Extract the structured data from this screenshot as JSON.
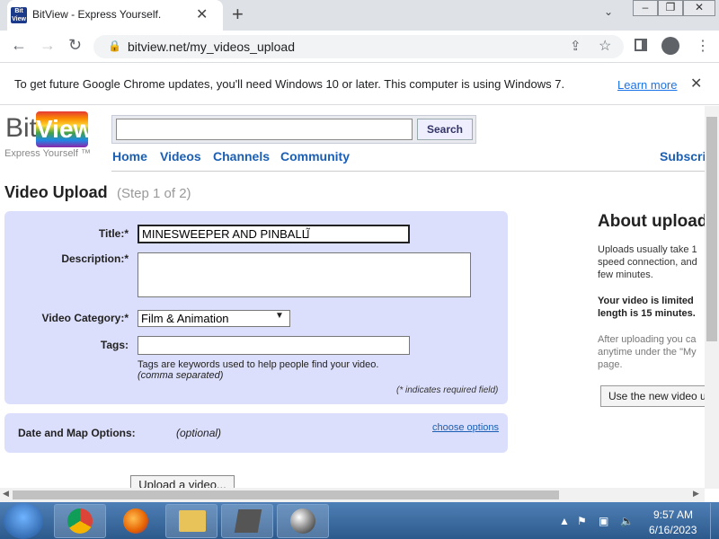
{
  "browser": {
    "tab_title": "BitView - Express Yourself.",
    "favicon_text": "Bit View",
    "url": "bitview.net/my_videos_upload"
  },
  "infobar": {
    "message": "To get future Google Chrome updates, you'll need Windows 10 or later. This computer is using Windows 7.",
    "learn_more": "Learn more"
  },
  "site": {
    "logo_bit": "Bit",
    "logo_view": "View",
    "tagline": "Express Yourself ™",
    "search_button": "Search",
    "nav": [
      "Home",
      "Videos",
      "Channels",
      "Community"
    ],
    "subscriptions": "Subscrip"
  },
  "upload": {
    "title": "Video Upload",
    "step": "(Step 1 of 2)",
    "labels": {
      "title": "Title:*",
      "description": "Description:*",
      "category": "Video Category:*",
      "tags": "Tags:"
    },
    "title_value": "MINESWEEPER AND PINBALL",
    "category_value": "Film & Animation",
    "tags_help": "Tags are keywords used to help people find your video.",
    "tags_help2": "(comma separated)",
    "required_note": "(* indicates required field)",
    "date_label": "Date and Map Options:",
    "date_optional": "(optional)",
    "choose_options": "choose options",
    "upload_button": "Upload a video..."
  },
  "sidebar": {
    "title": "About upload",
    "p1_l1": "Uploads usually take 1",
    "p1_l2": "speed connection, and",
    "p1_l3": "few minutes.",
    "p2_l1": "Your video is limited",
    "p2_l2": "length is 15 minutes.",
    "p3_l1": "After uploading you ca",
    "p3_l2": "anytime under the \"My",
    "p3_l3": "page.",
    "button": "Use the new video u"
  },
  "taskbar": {
    "time": "9:57 AM",
    "date": "6/16/2023"
  },
  "colors": {
    "form_bg": "#dcdffc",
    "link": "#1a5fb4",
    "taskbar": "#2d5a8c"
  }
}
